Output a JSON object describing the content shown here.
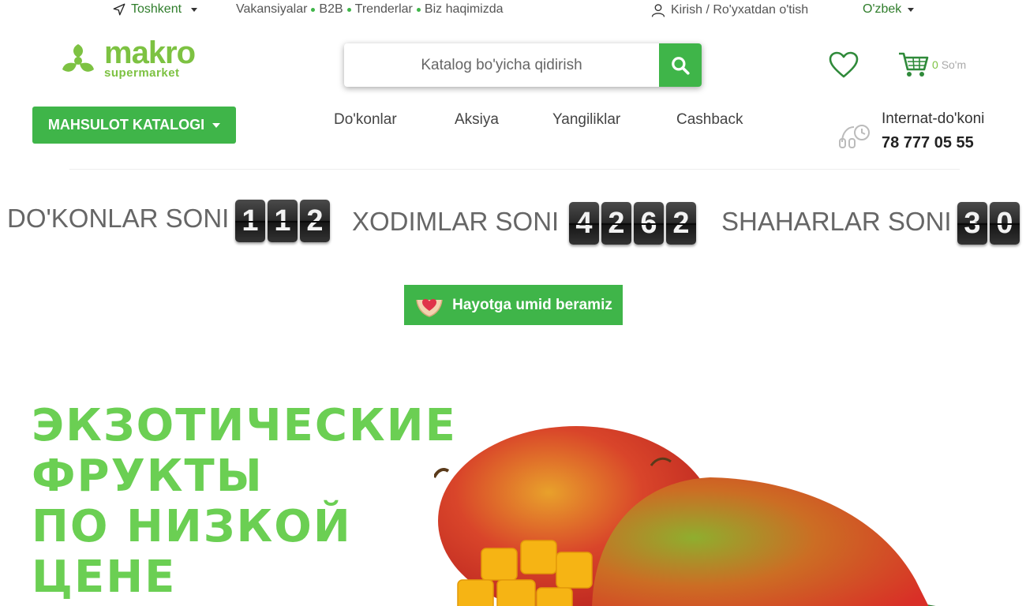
{
  "topbar": {
    "city": "Toshkent",
    "links": [
      "Vakansiyalar",
      "B2B",
      "Trenderlar",
      "Biz haqimizda"
    ],
    "login": "Kirish / Ro'yxatdan o'tish",
    "language": "O'zbek"
  },
  "header": {
    "logo_main": "makro",
    "logo_sub": "supermarket",
    "search_placeholder": "Katalog bo'yicha qidirish",
    "cart_count": "0",
    "cart_currency": "So'm"
  },
  "nav": {
    "catalog_button": "MAHSULOT KATALOGI",
    "items": [
      "Do'konlar",
      "Aksiya",
      "Yangiliklar",
      "Cashback"
    ],
    "phone_label": "Internat-do'koni",
    "phone_number": "78 777 05 55"
  },
  "counters": [
    {
      "label": "DO'KONLAR SONI",
      "digits": [
        "1",
        "1",
        "2"
      ]
    },
    {
      "label": "XODIMLAR SONI",
      "digits": [
        "4",
        "2",
        "6",
        "2"
      ]
    },
    {
      "label": "SHAHARLAR SONI",
      "digits": [
        "3",
        "0"
      ]
    }
  ],
  "charity_button": "Hayotga umid beramiz",
  "banner": {
    "headline": [
      "ЭКЗОТИЧЕСКИЕ",
      "ФРУКТЫ",
      "ПО НИЗКОЙ",
      "ЦЕНЕ"
    ]
  },
  "colors": {
    "brand_green": "#3fb549",
    "logo_green": "#7dc242",
    "banner_text": "#6bcf53"
  }
}
